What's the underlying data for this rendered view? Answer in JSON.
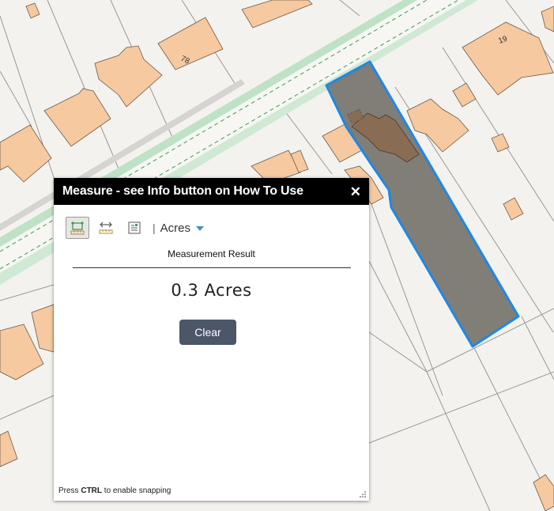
{
  "map": {
    "house_labels": [
      "78",
      "19"
    ],
    "colors": {
      "background": "#f4f2ee",
      "building": "#f6c9a0",
      "road_green": "#b8dcc0",
      "selection_fill": "#7a7670",
      "selection_stroke": "#1e88e5"
    }
  },
  "widget": {
    "title": "Measure - see Info button on How To Use",
    "close_label": "✕",
    "tools": [
      {
        "name": "area",
        "icon": "area-measure-icon",
        "active": true
      },
      {
        "name": "distance",
        "icon": "distance-measure-icon",
        "active": false
      },
      {
        "name": "location",
        "icon": "location-measure-icon",
        "active": false
      }
    ],
    "separator": "|",
    "unit_selected": "Acres",
    "result_label": "Measurement Result",
    "result_value": "0.3 Acres",
    "clear_label": "Clear",
    "snap_hint_prefix": "Press ",
    "snap_hint_key": "CTRL",
    "snap_hint_suffix": " to enable snapping"
  }
}
